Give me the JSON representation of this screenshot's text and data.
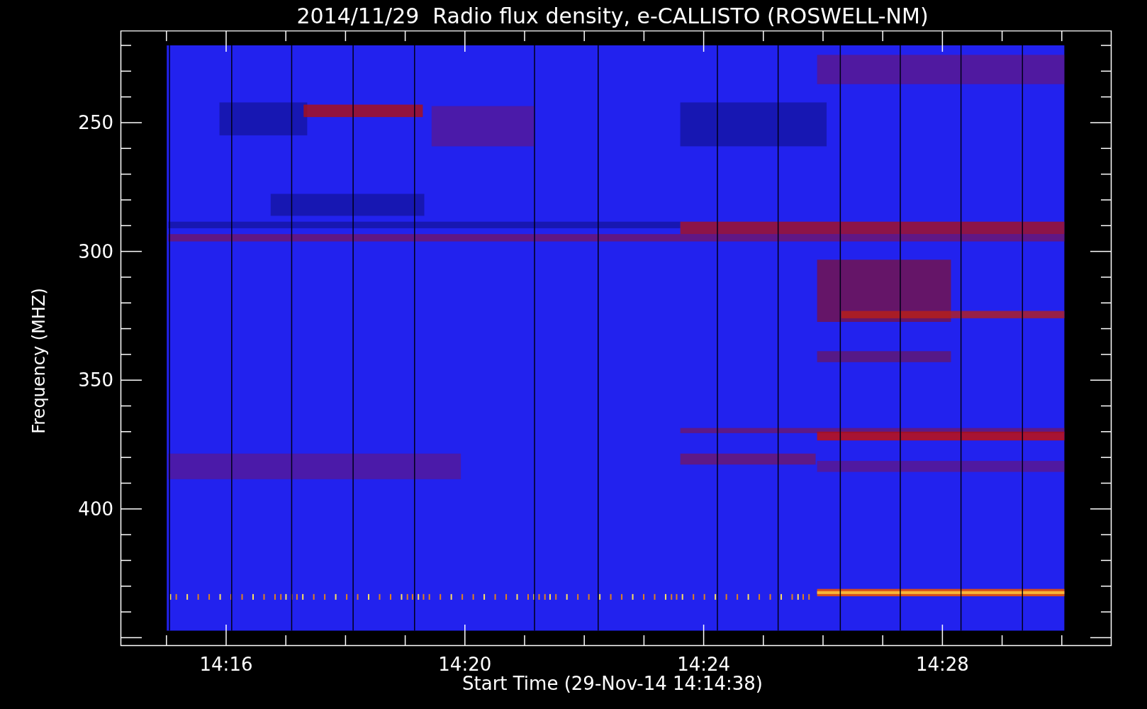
{
  "title": "2014/11/29  Radio flux density, e-CALLISTO (ROSWELL-NM)",
  "plot": {
    "ylabel": "Frequency (MHZ)",
    "xlabel": "Start Time (29-Nov-14 14:14:38)",
    "yticks": [
      "250",
      "300",
      "350",
      "400"
    ],
    "xticks": [
      "14:16",
      "14:20",
      "14:24",
      "14:28"
    ]
  }
}
